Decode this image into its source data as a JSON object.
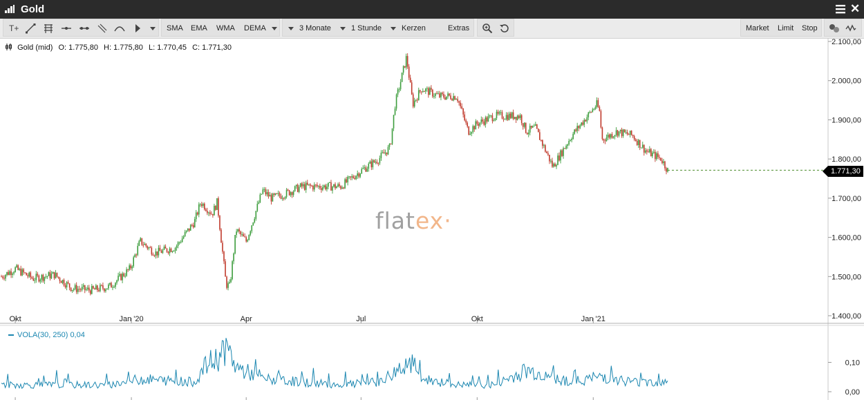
{
  "window": {
    "title": "Gold"
  },
  "toolbar": {
    "text_tool": "T+",
    "indicators": [
      "SMA",
      "EMA",
      "WMA",
      "DEMA"
    ],
    "period": "3 Monate",
    "interval": "1 Stunde",
    "chart_style": "Kerzen",
    "extras": "Extras",
    "orders": [
      "Market",
      "Limit",
      "Stop"
    ]
  },
  "legend": {
    "instrument": "Gold (mid)",
    "open": "O: 1.775,80",
    "high": "H: 1.775,80",
    "low": "L: 1.770,45",
    "close": "C: 1.771,30"
  },
  "current_price_label": "1.771,30",
  "watermark": {
    "main": "flat",
    "accent": "ex",
    "dot": "·"
  },
  "indicator_panel": {
    "label": "VOLA(30, 250)",
    "value": "0,04"
  },
  "colors": {
    "up": "#3c9c3c",
    "down": "#c0392b",
    "vola": "#1a86b0",
    "current_line": "#4a8a2a"
  },
  "chart_data": {
    "type": "line",
    "subtype": "candlestick",
    "title": "Gold",
    "x_ticks": [
      "Okt",
      "Jan '20",
      "Apr",
      "Jul",
      "Okt",
      "Jan '21"
    ],
    "y_ticks": [
      "2.100,00",
      "2.000,00",
      "1.900,00",
      "1.800,00",
      "1.700,00",
      "1.600,00",
      "1.500,00",
      "1.400,00"
    ],
    "ylim": [
      1400,
      2100
    ],
    "last_price": 1771.3,
    "series": [
      {
        "name": "Gold (mid)",
        "x": [
          "2019-09-20",
          "2019-10-01",
          "2019-10-15",
          "2019-11-01",
          "2019-11-15",
          "2019-12-01",
          "2019-12-15",
          "2019-12-31",
          "2020-01-08",
          "2020-01-20",
          "2020-02-05",
          "2020-02-20",
          "2020-02-25",
          "2020-03-05",
          "2020-03-09",
          "2020-03-16",
          "2020-03-19",
          "2020-03-24",
          "2020-04-01",
          "2020-04-14",
          "2020-04-21",
          "2020-05-01",
          "2020-05-15",
          "2020-06-01",
          "2020-06-15",
          "2020-07-01",
          "2020-07-15",
          "2020-07-24",
          "2020-07-28",
          "2020-08-06",
          "2020-08-11",
          "2020-08-18",
          "2020-09-01",
          "2020-09-15",
          "2020-09-24",
          "2020-10-01",
          "2020-10-15",
          "2020-11-04",
          "2020-11-09",
          "2020-11-16",
          "2020-11-30",
          "2020-12-15",
          "2021-01-04",
          "2021-01-06",
          "2021-01-08",
          "2021-01-20",
          "2021-02-01",
          "2021-02-12",
          "2021-02-24",
          "2021-03-01"
        ],
        "values": [
          1500,
          1520,
          1495,
          1505,
          1470,
          1465,
          1475,
          1520,
          1590,
          1560,
          1575,
          1640,
          1690,
          1660,
          1690,
          1480,
          1475,
          1620,
          1590,
          1720,
          1700,
          1710,
          1730,
          1730,
          1730,
          1770,
          1800,
          1830,
          1940,
          2060,
          1940,
          1980,
          1960,
          1960,
          1870,
          1890,
          1910,
          1910,
          1870,
          1880,
          1780,
          1860,
          1940,
          1920,
          1850,
          1870,
          1860,
          1820,
          1800,
          1771.3
        ]
      },
      {
        "name": "VOLA(30, 250)",
        "ylim": [
          0,
          0.2
        ],
        "x": [
          "2019-09-20",
          "2019-11-01",
          "2019-12-15",
          "2020-01-08",
          "2020-02-20",
          "2020-03-01",
          "2020-03-09",
          "2020-03-16",
          "2020-03-24",
          "2020-04-15",
          "2020-05-15",
          "2020-06-15",
          "2020-07-15",
          "2020-07-31",
          "2020-08-11",
          "2020-08-18",
          "2020-09-15",
          "2020-10-15",
          "2020-11-09",
          "2020-12-15",
          "2021-01-08",
          "2021-02-01",
          "2021-03-01"
        ],
        "values": [
          0.03,
          0.03,
          0.03,
          0.05,
          0.04,
          0.1,
          0.12,
          0.16,
          0.09,
          0.05,
          0.04,
          0.03,
          0.04,
          0.08,
          0.1,
          0.05,
          0.03,
          0.03,
          0.08,
          0.04,
          0.06,
          0.04,
          0.04
        ]
      }
    ]
  }
}
